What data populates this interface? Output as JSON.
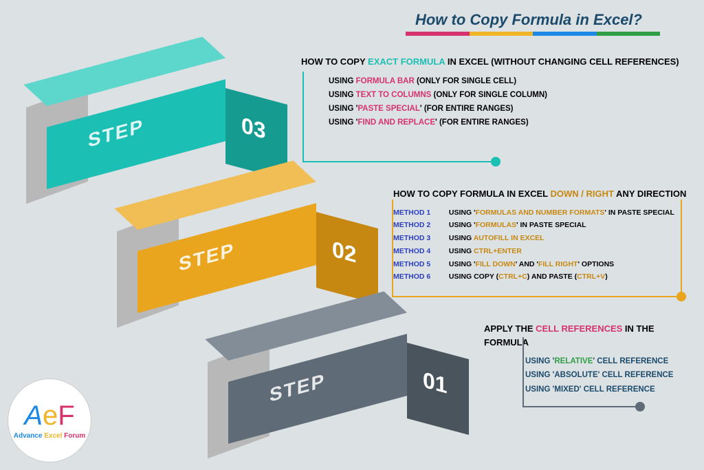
{
  "title": "How to Copy Formula in Excel?",
  "rainbow_colors": [
    "#d6336c",
    "#f0b429",
    "#1e88e5",
    "#2f9e44"
  ],
  "step3": {
    "label": "STEP",
    "num": "03",
    "heading_pre": "HOW TO COPY ",
    "heading_hl": "EXACT FORMULA",
    "heading_post": " IN EXCEL (WITHOUT CHANGING CELL REFERENCES)",
    "items": [
      {
        "pre": "USING ",
        "hl": "FORMULA BAR",
        "post": " (ONLY FOR SINGLE CELL)",
        "hlClass": "hl-pink"
      },
      {
        "pre": "USING ",
        "hl": "TEXT TO COLUMNS",
        "post": " (ONLY FOR SINGLE COLUMN)",
        "hlClass": "hl-pink"
      },
      {
        "pre": "USING '",
        "hl": "PASTE SPECIAL",
        "post": "' (FOR ENTIRE RANGES)",
        "hlClass": "hl-pink"
      },
      {
        "pre": "USING '",
        "hl": "FIND AND REPLACE",
        "post": "' (FOR ENTIRE RANGES)",
        "hlClass": "hl-pink"
      }
    ]
  },
  "step2": {
    "label": "STEP",
    "num": "02",
    "heading_pre": "HOW TO COPY FORMULA IN EXCEL ",
    "heading_hl": "DOWN / RIGHT",
    "heading_post": " ANY DIRECTION",
    "methods": [
      {
        "m": "METHOD 1",
        "pre": "USING '",
        "hl": "FORMULAS AND NUMBER FORMATS",
        "post": "' IN PASTE SPECIAL"
      },
      {
        "m": "METHOD 2",
        "pre": "USING '",
        "hl": "FORMULAS",
        "post": "' IN PASTE SPECIAL"
      },
      {
        "m": "METHOD 3",
        "pre": "USING ",
        "hl": "AUTOFILL IN EXCEL",
        "post": ""
      },
      {
        "m": "METHOD 4",
        "pre": "USING ",
        "hl": "CTRL+ENTER",
        "post": ""
      },
      {
        "m": "METHOD 5",
        "pre": "USING '",
        "hl": "FILL DOWN",
        "mid": "' AND '",
        "hl2": "FILL RIGHT",
        "post": "' OPTIONS"
      },
      {
        "m": "METHOD 6",
        "pre": "USING COPY (",
        "hl": "CTRL+C",
        "mid": ") AND PASTE (",
        "hl2": "CTRL+V",
        "post": ")"
      }
    ]
  },
  "step1": {
    "label": "STEP",
    "num": "01",
    "heading_pre": "APPLY THE ",
    "heading_hl": "CELL REFERENCES",
    "heading_post": " IN THE FORMULA",
    "items": [
      {
        "pre": "USING '",
        "hl": "RELATIVE",
        "post": "' CELL REFERENCE",
        "hlClass": "hl-green"
      },
      {
        "pre": "USING '",
        "hl": "ABSOLUTE",
        "post": "' CELL REFERENCE",
        "hlClass": "hl-navy"
      },
      {
        "pre": "USING '",
        "hl": "MIXED",
        "post": "' CELL REFERENCE",
        "hlClass": "hl-navy"
      }
    ]
  },
  "logo": {
    "brand_a": "Advance",
    "brand_e": " Excel ",
    "brand_f": "Forum"
  }
}
